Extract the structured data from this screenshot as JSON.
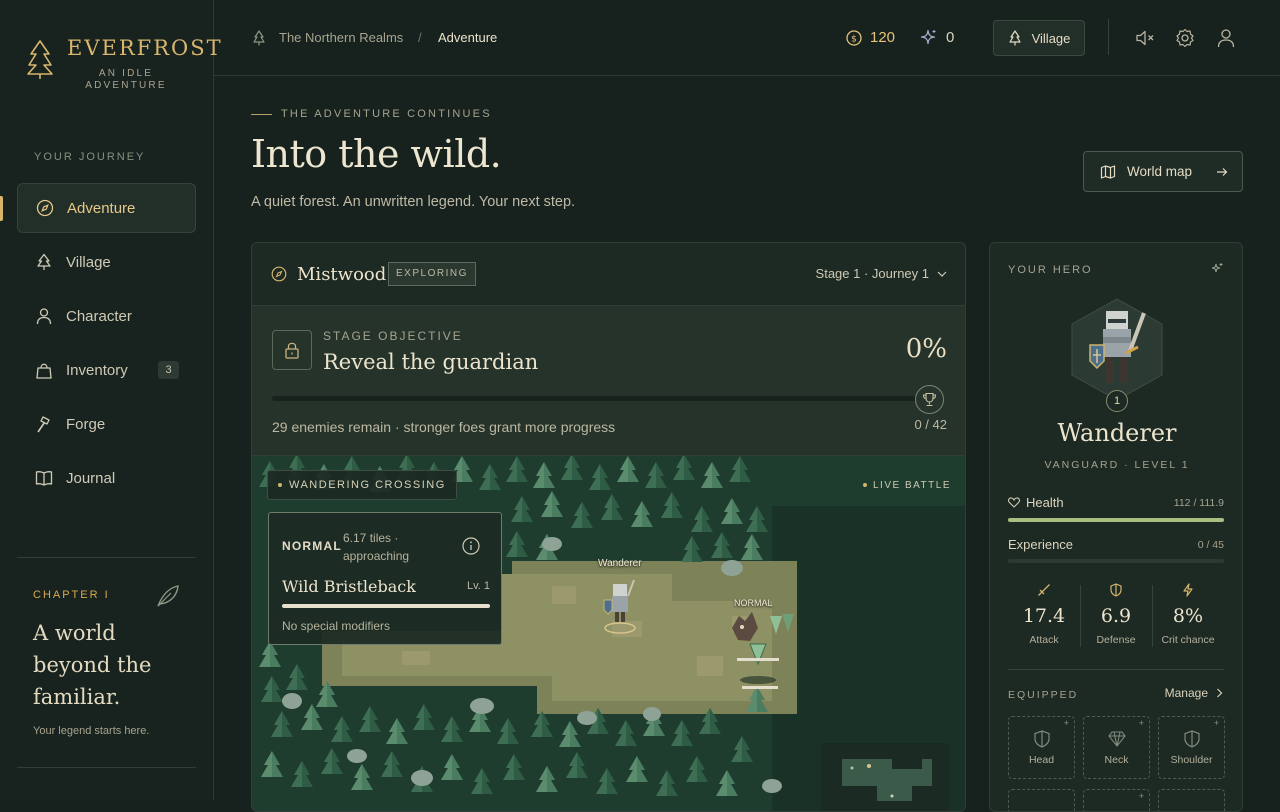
{
  "brand": {
    "name": "EVERFROST",
    "tagline": "AN IDLE ADVENTURE"
  },
  "nav": {
    "heading": "YOUR JOURNEY",
    "items": [
      {
        "label": "Adventure",
        "icon": "compass-icon",
        "active": true
      },
      {
        "label": "Village",
        "icon": "tree-icon"
      },
      {
        "label": "Character",
        "icon": "person-icon"
      },
      {
        "label": "Inventory",
        "icon": "bag-icon",
        "badge": "3"
      },
      {
        "label": "Forge",
        "icon": "hammer-icon"
      },
      {
        "label": "Journal",
        "icon": "book-icon"
      }
    ]
  },
  "chapter": {
    "label": "CHAPTER I",
    "title": "A world beyond the familiar.",
    "subtitle": "Your legend starts here."
  },
  "topbar": {
    "breadcrumb_root": "The Northern Realms",
    "breadcrumb_sep": "/",
    "breadcrumb_current": "Adventure",
    "gold": "120",
    "essence": "0",
    "village_button": "Village"
  },
  "page": {
    "eyebrow": "THE ADVENTURE CONTINUES",
    "title": "Into the wild.",
    "subtitle": "A quiet forest. An unwritten legend. Your next step.",
    "world_map_button": "World map"
  },
  "adventure": {
    "location": "Mistwood",
    "status": "EXPLORING",
    "stage": "Stage 1 · Journey 1",
    "objective_label": "STAGE OBJECTIVE",
    "objective_title": "Reveal the guardian",
    "objective_percent": "0%",
    "objective_progress": 0,
    "objective_note": "29 enemies remain · stronger foes grant more progress",
    "objective_count": "0 / 42"
  },
  "battle": {
    "zone": "WANDERING CROSSING",
    "live_label": "LIVE BATTLE",
    "hero_label": "Wanderer",
    "enemy_label": "NORMAL",
    "target": {
      "kind": "NORMAL",
      "distance": "6.17 tiles · approaching",
      "name": "Wild Bristleback",
      "level": "Lv. 1",
      "health_fraction": 1.0,
      "modifiers": "No special modifiers"
    }
  },
  "hero": {
    "heading": "YOUR HERO",
    "level_badge": "1",
    "name": "Wanderer",
    "class_line": "VANGUARD   ·   LEVEL 1",
    "health_label": "Health",
    "health_value": "112 / 111.9",
    "health_fraction": 1.0,
    "xp_label": "Experience",
    "xp_value": "0 / 45",
    "xp_fraction": 0,
    "stats": [
      {
        "value": "17.4",
        "label": "Attack",
        "icon": "sword-icon"
      },
      {
        "value": "6.9",
        "label": "Defense",
        "icon": "shield-icon"
      },
      {
        "value": "8%",
        "label": "Crit chance",
        "icon": "bolt-icon"
      }
    ],
    "equipped_label": "EQUIPPED",
    "manage_label": "Manage",
    "slots": [
      "Head",
      "Neck",
      "Shoulder"
    ]
  },
  "colors": {
    "accent": "#d9b56a",
    "background": "#17221e",
    "panel": "#1d2923",
    "health": "#a8bd7f"
  }
}
